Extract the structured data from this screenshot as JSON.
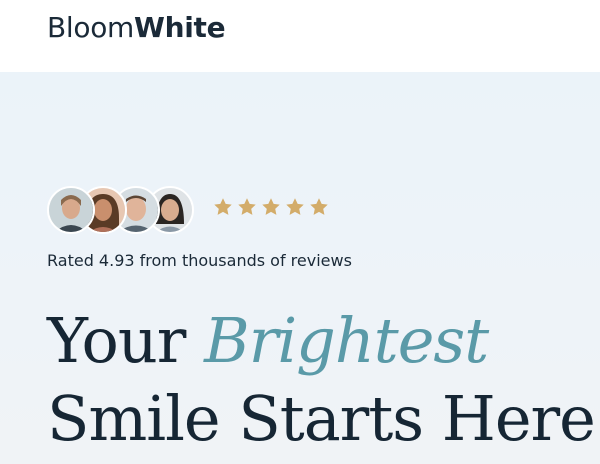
{
  "header": {
    "logo_light": "Bloom",
    "logo_bold": "White"
  },
  "reviews": {
    "avatars": [
      "customer-avatar-1",
      "customer-avatar-2",
      "customer-avatar-3",
      "customer-avatar-4"
    ],
    "star_count": 5,
    "rating": 4.93,
    "rated_text": "Rated 4.93 from thousands of reviews"
  },
  "hero": {
    "headline_line1_prefix": "Your ",
    "headline_line1_accent": "Brightest",
    "headline_line2": "Smile Starts Here"
  },
  "colors": {
    "accent": "#5a9aa8",
    "star": "#d3ac6a",
    "text_dark": "#162634",
    "header_bg": "#ffffff",
    "hero_bg": "#edf3f9"
  }
}
